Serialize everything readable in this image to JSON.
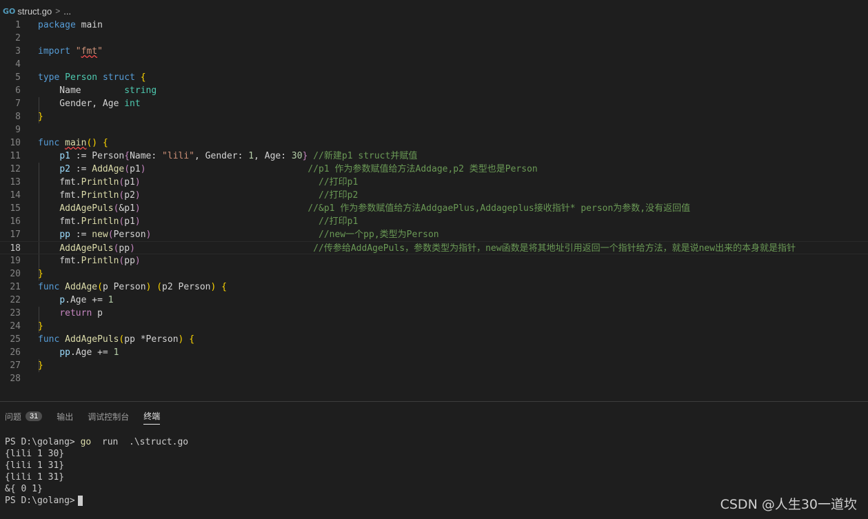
{
  "breadcrumb": {
    "icon": "go-file-icon",
    "icon_text": "GO",
    "file": "struct.go",
    "separator": ">",
    "more": "..."
  },
  "editor": {
    "current_line": 18,
    "line_numbers": [
      "1",
      "2",
      "3",
      "4",
      "5",
      "6",
      "7",
      "8",
      "9",
      "10",
      "11",
      "12",
      "13",
      "14",
      "15",
      "16",
      "17",
      "18",
      "19",
      "20",
      "21",
      "22",
      "23",
      "24",
      "25",
      "26",
      "27",
      "28"
    ]
  },
  "panel": {
    "tabs": [
      {
        "label": "问题",
        "badge": "31"
      },
      {
        "label": "输出"
      },
      {
        "label": "调试控制台"
      },
      {
        "label": "终端",
        "active": true
      }
    ]
  },
  "terminal": {
    "prompt1": "PS D:\\golang>",
    "cmd_go": "go",
    "cmd_rest": "  run  .\\struct.go",
    "out1": "{lili 1 30}",
    "out2": "{lili 1 31}",
    "out3": "{lili 1 31}",
    "out4": "&{ 0 1}",
    "prompt2": "PS D:\\golang>"
  },
  "watermark": "CSDN @人生30一道坎"
}
